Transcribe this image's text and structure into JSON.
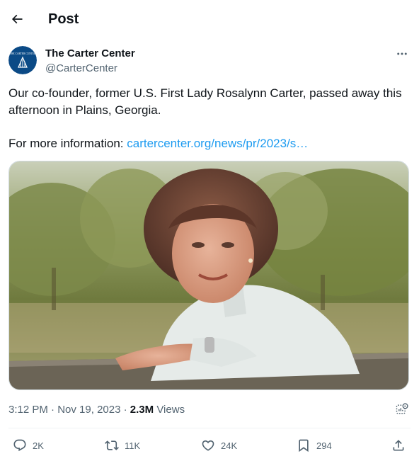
{
  "header": {
    "title": "Post"
  },
  "author": {
    "name": "The Carter Center",
    "handle": "@CarterCenter",
    "avatar_text": "THE CARTER CENTER"
  },
  "tweet": {
    "line1": "Our co-founder, former U.S. First Lady Rosalynn Carter, passed away this afternoon in Plains, Georgia.",
    "link_prefix": "For more information: ",
    "link_text": "cartercenter.org/news/pr/2023/s…"
  },
  "meta": {
    "time": "3:12 PM",
    "separator1": " · ",
    "date": "Nov 19, 2023",
    "separator2": " · ",
    "views_count": "2.3M",
    "views_label": " Views"
  },
  "actions": {
    "replies": "2K",
    "reposts": "11K",
    "likes": "24K",
    "bookmarks": "294"
  },
  "colors": {
    "accent": "#1d9bf0",
    "text_primary": "#0f1419",
    "text_secondary": "#536471",
    "avatar_bg": "#0b4a86"
  },
  "icons": [
    "back-arrow-icon",
    "more-icon",
    "analytics-icon",
    "reply-icon",
    "repost-icon",
    "like-icon",
    "bookmark-icon",
    "share-icon"
  ]
}
